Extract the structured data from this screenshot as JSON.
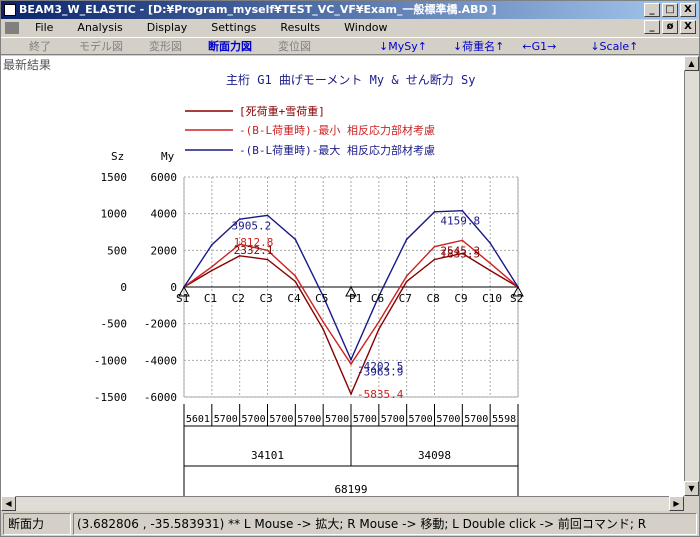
{
  "window": {
    "title": "BEAM3_W_ELASTIC - [D:¥Program_myself¥TEST_VC_VF¥Exam_一般標準橋.ABD ]",
    "buttons": [
      "_",
      "□",
      "X"
    ],
    "inner_buttons": [
      "_",
      "ø",
      "X"
    ]
  },
  "menu": [
    {
      "label": "File"
    },
    {
      "label": "Analysis"
    },
    {
      "label": "Display"
    },
    {
      "label": "Settings"
    },
    {
      "label": "Results"
    },
    {
      "label": "Window"
    }
  ],
  "toolbar": {
    "end": "終了",
    "model": "モデル図",
    "deform": "変形図",
    "section_force": "断面力図",
    "displacement": "変位図",
    "mysy": "↓MySy↑",
    "load_name": "↓荷重名↑",
    "girder": "←G1→",
    "scale": "↓Scale↑"
  },
  "canvas": {
    "corner_label": "最新結果",
    "chart_title": "主桁 G1 曲げモーメント My & せん断力 Sy",
    "legend": [
      {
        "label": "[死荷重+雪荷重]",
        "color": "#880000"
      },
      {
        "label": "-(B-L荷重時)-最小 相反応力部材考慮",
        "color": "#cc2222"
      },
      {
        "label": "-(B-L荷重時)-最大 相反応力部材考慮",
        "color": "#1a1a88"
      }
    ],
    "axis_headers": {
      "sz": "Sz",
      "my": "My"
    },
    "sz_ticks": [
      "-1500",
      "-1000",
      "-500",
      "0",
      "500",
      "1000",
      "1500"
    ],
    "my_ticks": [
      "-6000",
      "-4000",
      "-2000",
      "0",
      "2000",
      "4000",
      "6000"
    ],
    "node_labels": [
      "S1",
      "C1",
      "C2",
      "C3",
      "C4",
      "C5",
      "P1",
      "C6",
      "C7",
      "C8",
      "C9",
      "C10",
      "S2"
    ],
    "value_labels": {
      "peak1": "-5835.4",
      "peak2": "-4202.5",
      "peak3": "-3963.9",
      "left_min": "1812.8",
      "left_mid": "2332.1",
      "left_max": "3905.2",
      "right_min": "1833.5",
      "right_mid": "2545.3",
      "right_max": "4159.8"
    },
    "segment_dims": [
      "5601",
      "5700",
      "5700",
      "5700",
      "5700",
      "5700",
      "5700",
      "5700",
      "5700",
      "5700",
      "5700",
      "5598"
    ],
    "span_dims": [
      "34101",
      "34098"
    ],
    "total_dim": "68199"
  },
  "status": {
    "mode": "断面力",
    "message": "(3.682806 , -35.583931) ** L Mouse -> 拡大; R Mouse -> 移動; L Double click -> 前回コマンド; R"
  },
  "chart_data": {
    "type": "line",
    "title": "主桁 G1 曲げモーメント My & せん断力 Sy",
    "x": [
      "S1",
      "C1",
      "C2",
      "C3",
      "C4",
      "C5",
      "P1",
      "C6",
      "C7",
      "C8",
      "C9",
      "C10",
      "S2"
    ],
    "ylabel": "My",
    "ylim": [
      6000,
      -6000
    ],
    "series": [
      {
        "name": "[死荷重+雪荷重]",
        "values": [
          0,
          900,
          1700,
          1500,
          300,
          -2300,
          -5835.4,
          -2300,
          300,
          1500,
          1833.5,
          900,
          0
        ]
      },
      {
        "name": "-(B-L荷重時)-最小 相反応力部材考慮",
        "values": [
          0,
          1100,
          2332.1,
          2000,
          600,
          -1900,
          -4202.5,
          -1900,
          600,
          2200,
          2545.3,
          1300,
          0
        ]
      },
      {
        "name": "-(B-L荷重時)-最大 相反応力部材考慮",
        "values": [
          0,
          2300,
          3700,
          3905.2,
          2600,
          -500,
          -3963.9,
          -500,
          2600,
          4100,
          4159.8,
          2400,
          0
        ]
      }
    ]
  }
}
